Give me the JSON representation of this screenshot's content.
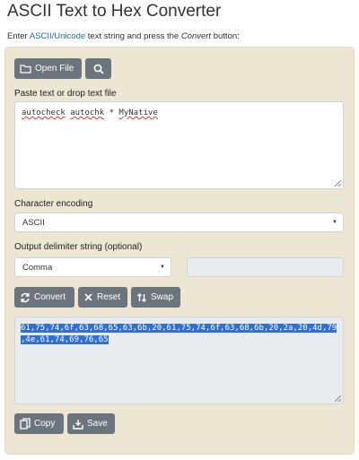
{
  "header": {
    "title": "ASCII Text to Hex Converter",
    "intro_prefix": "Enter ",
    "intro_link": "ASCII/Unicode",
    "intro_mid": " text string and press the ",
    "intro_em": "Convert",
    "intro_suffix": " button:"
  },
  "toolbar": {
    "open_file_label": "Open File"
  },
  "input": {
    "label": "Paste text or drop text file",
    "word1": "autocheck",
    "word2": "autochk",
    "word3": "* ",
    "word4": "MyNative"
  },
  "encoding": {
    "label": "Character encoding",
    "selected": "ASCII"
  },
  "delimiter": {
    "label": "Output delimiter string (optional)",
    "selected": "Comma"
  },
  "actions": {
    "convert_label": "Convert",
    "reset_label": "Reset",
    "swap_label": "Swap"
  },
  "output": {
    "line1": "61,75,74,6f,63,68,65,63,6b,20,61,75,74,6f,63,68,6b,20,2a,20,4d,79",
    "line2": ",4e,61,74,69,76,65"
  },
  "bottom": {
    "copy_label": "Copy",
    "save_label": "Save"
  },
  "colors": {
    "panel_bg": "#ede6d3",
    "button_bg": "#6c757d",
    "selection": "#2f6fd6",
    "link": "#1a6fb0"
  }
}
